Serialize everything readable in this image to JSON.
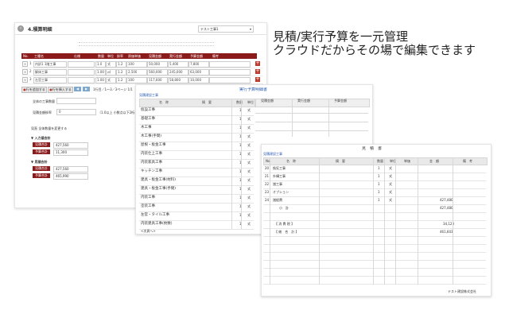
{
  "headline": {
    "line1": "見積/実行予算を一元管理",
    "line2": "クラウドだからその場で編集できます"
  },
  "panel_detail": {
    "title": "4.積算明細",
    "select_label": "テスト工事1",
    "columns": [
      "No.",
      "工種名",
      "仕様",
      "数量",
      "単位",
      "掛率",
      "原価単価",
      "見積金額",
      "実行金額",
      "予算金額",
      "備考"
    ],
    "rows": [
      {
        "no": "1",
        "name": "内訳1 1階工事",
        "qty": "1.0",
        "unit": "式",
        "rate": "1.2",
        "c1": "100",
        "c2": "50,000",
        "c3": "5,400",
        "c4": "7,800"
      },
      {
        "no": "2",
        "name": "解体工事",
        "qty": "1.00",
        "unit": "㎡",
        "rate": "1.2",
        "c1": "2,500",
        "c2": "560,000",
        "c3": "245,000",
        "c4": "63,000"
      },
      {
        "no": "3",
        "name": "左官工事",
        "qty": "1.00",
        "unit": "式",
        "rate": "1.2",
        "c1": "100",
        "c2": "117,600",
        "c3": "58,800",
        "c4": "10,000"
      }
    ],
    "btn_add": "行を追加する",
    "btn_copy": "行を挿入する",
    "page_info": "1行目／1～3／3ページ 1/1",
    "label_total_qty": "全体の工事数量",
    "label_rate": "見積金額掛率",
    "rate_value": "0",
    "rate_note": "（1.0以上 小数点以下2桁まで）",
    "section_note": "見直 全体数量を変更する",
    "section_a_title": "▼ 入力値合計",
    "section_b_title": "▼ 見積合計",
    "tag_estimate": "見積合計",
    "tag_execute": "予算合計",
    "a_estimate_value": "427,560",
    "a_execute_value": "11,300",
    "b_estimate_value": "427,560",
    "b_execute_value": "465,990"
  },
  "panel_breakdown": {
    "title": "実行予算明細書",
    "subtitle": "見積建設工事",
    "cols": [
      "名　称",
      "摘　要",
      "数量",
      "単位"
    ],
    "right_headers": [
      "見積金額",
      "実行金額",
      "予算金額"
    ],
    "rows": [
      {
        "name": "仮設工事",
        "qty": "1",
        "unit": "式"
      },
      {
        "name": "基礎工事",
        "qty": "1",
        "unit": "式"
      },
      {
        "name": "木工事",
        "qty": "1",
        "unit": "式"
      },
      {
        "name": "木工事(手間)",
        "qty": "1",
        "unit": "式"
      },
      {
        "name": "屋根・板金工事",
        "qty": "1",
        "unit": "式"
      },
      {
        "name": "内装仕上工事",
        "qty": "1",
        "unit": "式"
      },
      {
        "name": "内装家具工事",
        "qty": "1",
        "unit": "式"
      },
      {
        "name": "キッチン工事",
        "qty": "1",
        "unit": "式"
      },
      {
        "name": "建具・板金工事(材料)",
        "qty": "1",
        "unit": "式"
      },
      {
        "name": "建具・板金工事(手間)",
        "qty": "1",
        "unit": "式"
      },
      {
        "name": "内装工事",
        "qty": "1",
        "unit": "式"
      },
      {
        "name": "塗装工事",
        "qty": "1",
        "unit": "式"
      },
      {
        "name": "左官・タイル工事",
        "qty": "1",
        "unit": "式"
      },
      {
        "name": "内装建具工事(枚数)",
        "qty": "1",
        "unit": "式"
      }
    ],
    "next_label": "<次頁へ>"
  },
  "panel_estimate": {
    "title": "見　積　書",
    "subtitle": "見積建設工事",
    "cols": [
      "No.",
      "名　称",
      "摘　要",
      "数量",
      "単位",
      "単価",
      "金　額",
      "備　考"
    ],
    "rows": [
      {
        "no": "20",
        "name": "換気工事",
        "qty": "1",
        "unit": "式",
        "amount": ""
      },
      {
        "no": "21",
        "name": "外構工事",
        "qty": "1",
        "unit": "式",
        "amount": ""
      },
      {
        "no": "22",
        "name": "諸工事",
        "qty": "1",
        "unit": "式",
        "amount": ""
      },
      {
        "no": "23",
        "name": "オプション",
        "qty": "1",
        "unit": "式",
        "amount": ""
      },
      {
        "no": "24",
        "name": "諸経費",
        "qty": "1",
        "unit": "式",
        "amount": "427,480"
      },
      {
        "no": "",
        "name": "小　計",
        "qty": "",
        "unit": "",
        "amount": "427,480"
      },
      {
        "no": "",
        "name": "",
        "qty": "",
        "unit": "",
        "amount": ""
      },
      {
        "no": "",
        "name": "【 消 費 税 】",
        "qty": "",
        "unit": "",
        "amount": "34,123"
      },
      {
        "no": "",
        "name": "【 総　合　計 】",
        "qty": "",
        "unit": "",
        "amount": "461,603"
      }
    ],
    "footer": "テスト建設株式会社"
  }
}
